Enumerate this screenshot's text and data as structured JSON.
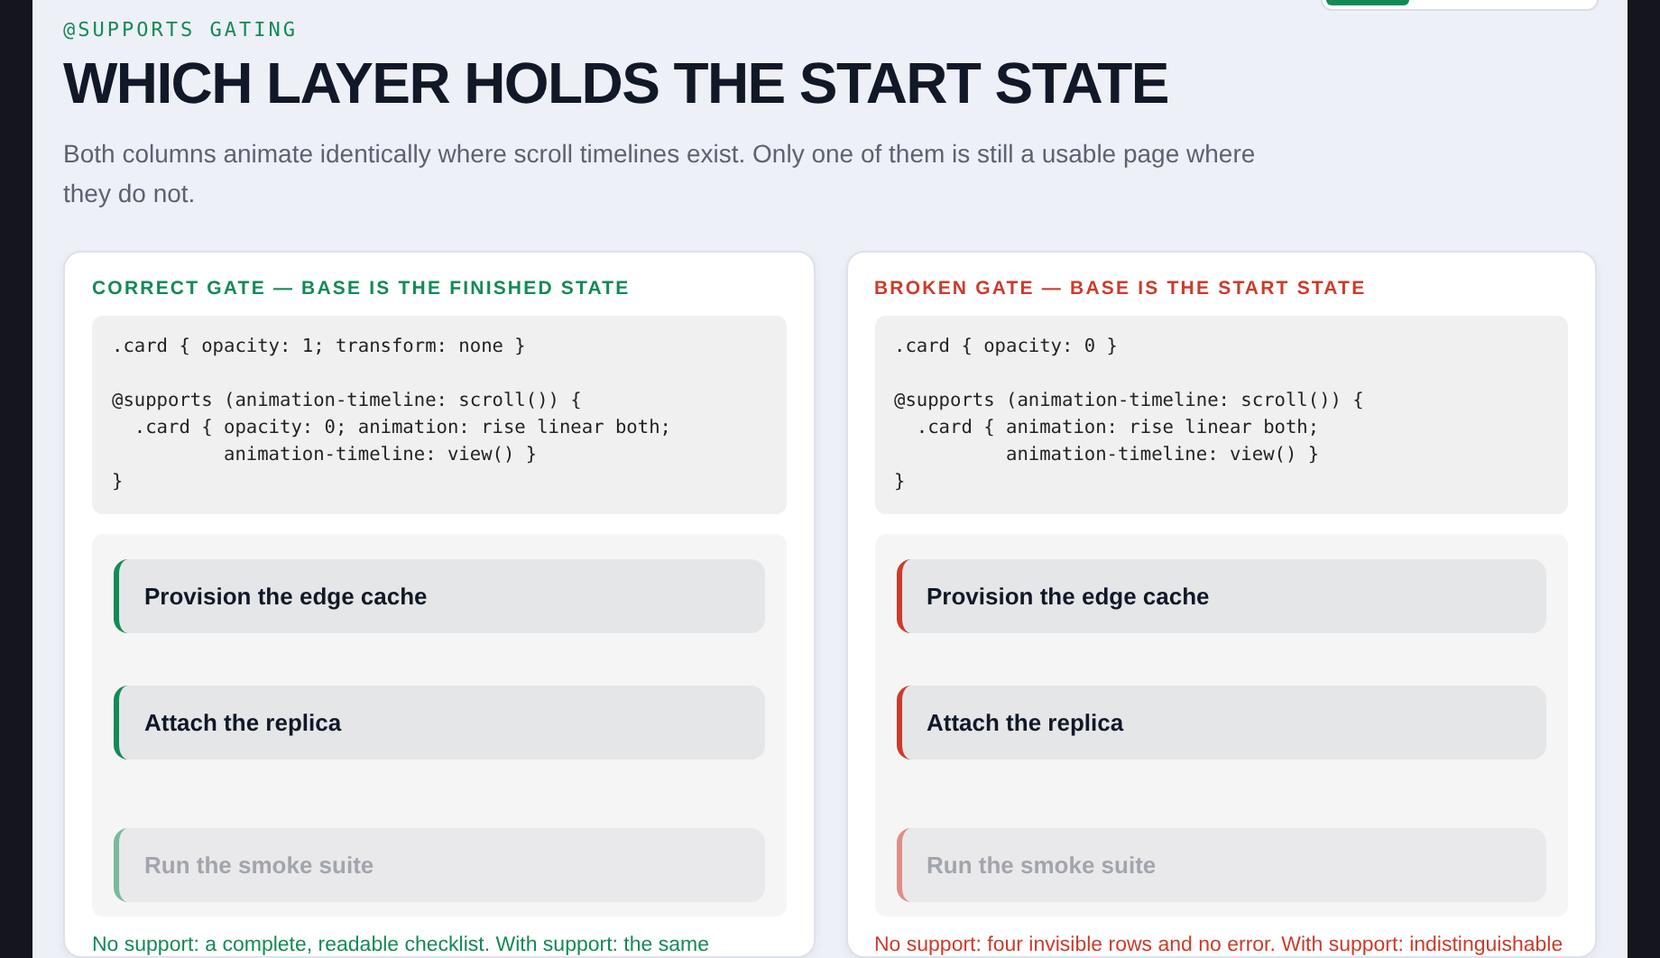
{
  "eyebrow": "@SUPPORTS GATING",
  "title": "WHICH LAYER HOLDS THE START STATE",
  "intro": "Both columns animate identically where scroll timelines exist. Only one of them is still a usable page where they do not.",
  "columns": [
    {
      "color": "#138a55",
      "heading": "CORRECT GATE — BASE IS THE FINISHED STATE",
      "code": ".card { opacity: 1; transform: none }\n\n@supports (animation-timeline: scroll()) {\n  .card { opacity: 0; animation: rise linear both;\n          animation-timeline: view() }\n}",
      "rows": [
        {
          "label": "Provision the edge cache",
          "dimmed": false
        },
        {
          "label": "Attach the replica",
          "dimmed": false
        },
        {
          "label": "Run the smoke suite",
          "dimmed": true
        }
      ],
      "caption": "No support: a complete, readable checklist. With support: the same"
    },
    {
      "color": "#cc3b2a",
      "heading": "BROKEN GATE — BASE IS THE START STATE",
      "code": ".card { opacity: 0 }\n\n@supports (animation-timeline: scroll()) {\n  .card { animation: rise linear both;\n          animation-timeline: view() }\n}",
      "rows": [
        {
          "label": "Provision the edge cache",
          "dimmed": false
        },
        {
          "label": "Attach the replica",
          "dimmed": false
        },
        {
          "label": "Run the smoke suite",
          "dimmed": true
        }
      ],
      "caption": "No support: four invisible rows and no error. With support: indistinguishable"
    }
  ]
}
